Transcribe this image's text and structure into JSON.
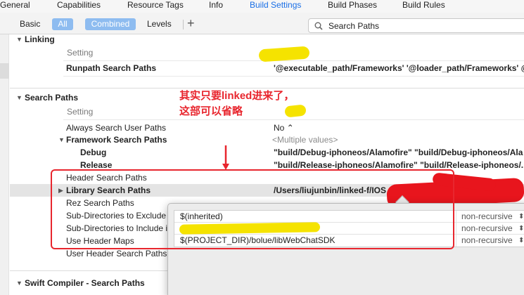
{
  "tabs": [
    "General",
    "Capabilities",
    "Resource Tags",
    "Info",
    "Build Settings",
    "Build Phases",
    "Build Rules"
  ],
  "filter": {
    "basic": "Basic",
    "all": "All",
    "combined": "Combined",
    "levels": "Levels",
    "add": "+",
    "search_value": "Search Paths"
  },
  "linking": {
    "title": "Linking",
    "column_header": "Setting",
    "rows": [
      {
        "label": "Runpath Search Paths",
        "value": "'@executable_path/Frameworks' '@loader_path/Frameworks' @..."
      }
    ]
  },
  "search_paths": {
    "title": "Search Paths",
    "column_header": "Setting",
    "always_search": {
      "label": "Always Search User Paths",
      "value": "No ⌃"
    },
    "framework": {
      "label": "Framework Search Paths",
      "value": "<Multiple values>"
    },
    "debug": {
      "label": "Debug",
      "value": "\"build/Debug-iphoneos/Alamofire\" \"build/Debug-iphoneos/Ala"
    },
    "release": {
      "label": "Release",
      "value": "\"build/Release-iphoneos/Alamofire\" \"build/Release-iphoneos/..."
    },
    "header": {
      "label": "Header Search Paths"
    },
    "library": {
      "label": "Library Search Paths",
      "value": "/Users/liujunbin/linked-f/IOS"
    },
    "rez": {
      "label": "Rez Search Paths"
    },
    "subdir_exclude": {
      "label": "Sub-Directories to Exclude"
    },
    "subdir_include": {
      "label": "Sub-Directories to Include i"
    },
    "use_header_maps": {
      "label": "Use Header Maps"
    },
    "user_header": {
      "label": "User Header Search Paths"
    }
  },
  "swift": {
    "title": "Swift Compiler - Search Paths"
  },
  "annotation": {
    "note": "其实只要linked进来了，这部可以省略"
  },
  "popover": {
    "rows": [
      {
        "value": "$(inherited)",
        "mode": "non-recursive"
      },
      {
        "value": "",
        "mode": "non-recursive"
      },
      {
        "value": "$(PROJECT_DIR)/bolue/libWebChatSDK",
        "mode": "non-recursive"
      }
    ]
  },
  "colors": {
    "accent": "#1a6fe6",
    "selected_filter": "#8ebcf0",
    "annotation_red": "#e8262e",
    "highlight_yellow": "#f5e300"
  }
}
